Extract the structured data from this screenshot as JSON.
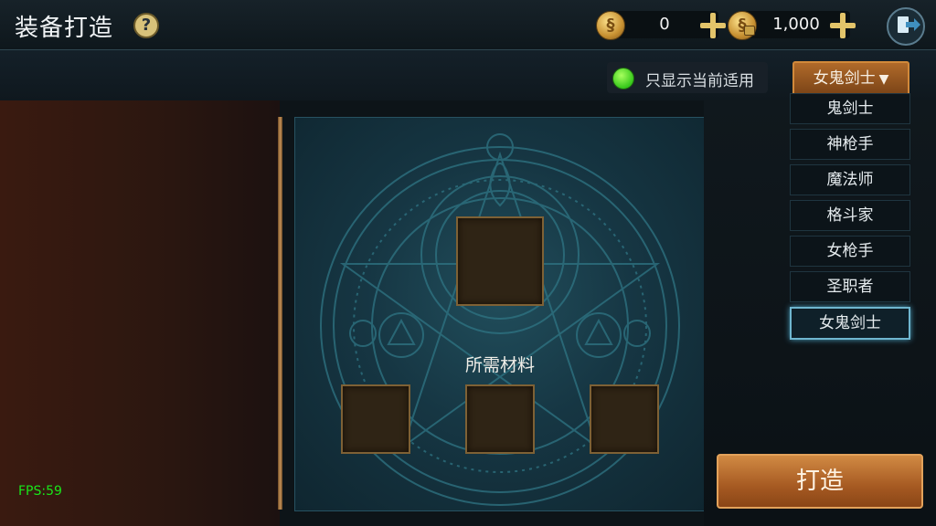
{
  "header": {
    "title": "装备打造",
    "help_icon": "question-icon",
    "currency1_value": "0",
    "currency2_value": "1,000",
    "currency1_icon": "gold-coin-icon",
    "currency2_icon": "bound-coin-icon"
  },
  "filter": {
    "only_current_label": "只显示当前适用",
    "selected_class": "女鬼剑士",
    "caret": "▼"
  },
  "class_options": [
    "鬼剑士",
    "神枪手",
    "魔法师",
    "格斗家",
    "女枪手",
    "圣职者",
    "女鬼剑士"
  ],
  "craft": {
    "materials_label": "所需材料",
    "forge_label": "打造"
  },
  "debug": {
    "fps": "FPS:59"
  },
  "colors": {
    "accent_orange": "#b06a2a",
    "toggle_green": "#36c81b",
    "fps_green": "#19e61a"
  }
}
